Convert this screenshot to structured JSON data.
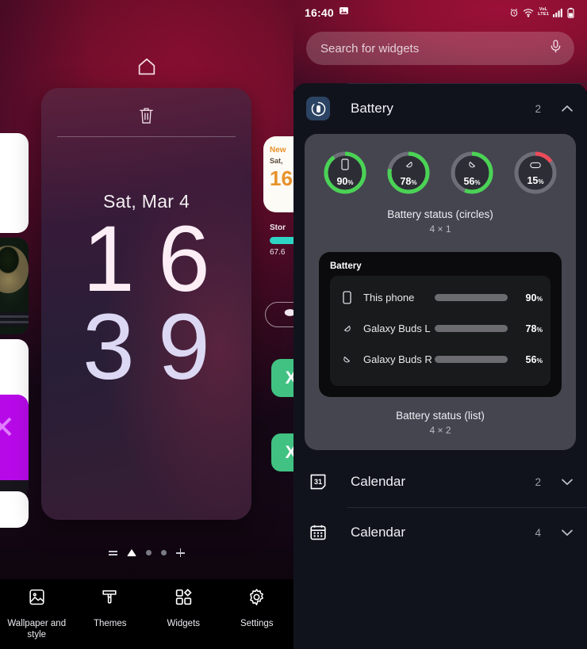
{
  "home": {
    "home_indicator_icon": "home-icon",
    "card": {
      "trash_icon": "trash-icon",
      "clock": {
        "date": "Sat, Mar 4",
        "hour_tens": "1",
        "hour_ones": "6",
        "min_tens": "3",
        "min_ones": "9"
      }
    },
    "right_previews": {
      "news_line1": "New",
      "news_line2": "Sat,",
      "news_big": "16",
      "storage_label": "Stor",
      "storage_value": "67.6",
      "excel_letter": "X"
    },
    "page_indicator": {
      "menu_icon": "hamburger-icon",
      "home_icon": "home-page-icon",
      "add_icon": "plus-icon"
    },
    "toolbar": [
      {
        "label": "Wallpaper and style",
        "icon": "wallpaper-icon"
      },
      {
        "label": "Themes",
        "icon": "brush-icon"
      },
      {
        "label": "Widgets",
        "icon": "widgets-icon"
      },
      {
        "label": "Settings",
        "icon": "gear-icon"
      }
    ]
  },
  "picker": {
    "status_bar": {
      "time": "16:40",
      "screenshot_icon": "image-icon",
      "alarm_icon": "alarm-icon",
      "wifi_icon": "wifi-icon",
      "volte_top": "VoL",
      "volte_bottom": "LTE1",
      "signal_icon": "signal-icon",
      "battery_icon": "battery-icon"
    },
    "search": {
      "placeholder": "Search for widgets",
      "mic_icon": "microphone-icon"
    },
    "sections": [
      {
        "name": "Battery",
        "icon": "battery-app-icon",
        "count": "2",
        "chevron": "chevron-up-icon",
        "expanded": true
      },
      {
        "name": "Calendar",
        "icon": "calendar-31-icon",
        "count": "2",
        "chevron": "chevron-down-icon",
        "expanded": false
      },
      {
        "name": "Calendar",
        "icon": "calendar-grid-icon",
        "count": "4",
        "chevron": "chevron-down-icon",
        "expanded": false
      }
    ],
    "widget_circles": {
      "caption": "Battery status (circles)",
      "size": "4 × 1",
      "items": [
        {
          "icon": "phone-icon",
          "percent": "90",
          "value": 90,
          "color": "#4ad355"
        },
        {
          "icon": "buds-left-icon",
          "percent": "78",
          "value": 78,
          "color": "#4ad355"
        },
        {
          "icon": "buds-right-icon",
          "percent": "56",
          "value": 56,
          "color": "#4ad355"
        },
        {
          "icon": "buds-case-icon",
          "percent": "15",
          "value": 15,
          "color": "#ec4b5a"
        }
      ]
    },
    "widget_list": {
      "caption": "Battery status (list)",
      "size": "4 × 2",
      "title": "Battery",
      "rows": [
        {
          "icon": "phone-icon",
          "name": "This phone",
          "percent": "90",
          "value": 90
        },
        {
          "icon": "buds-left-icon",
          "name": "Galaxy Buds L",
          "percent": "78",
          "value": 78
        },
        {
          "icon": "buds-right-icon",
          "name": "Galaxy Buds R",
          "percent": "56",
          "value": 56
        }
      ]
    }
  }
}
